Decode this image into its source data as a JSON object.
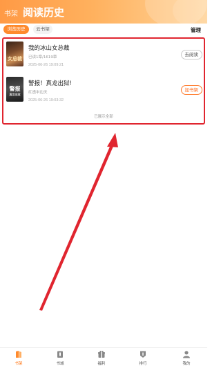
{
  "header": {
    "tabs": [
      {
        "label": "书架",
        "active": false
      },
      {
        "label": "阅读历史",
        "active": true
      }
    ]
  },
  "subbar": {
    "filters": [
      {
        "label": "浏览历史",
        "active": true
      },
      {
        "label": "云书架",
        "active": false
      }
    ],
    "manage_label": "管理"
  },
  "books": [
    {
      "title": "我的冰山女总裁",
      "progress": "已读1章/1619章",
      "time": "2025-06-26 19:09:21",
      "action": "去阅读",
      "cover_text": "女总裁"
    },
    {
      "title": "警报！真龙出狱!",
      "progress": "红透半边天",
      "time": "2025-06-26 19:03:32",
      "action": "加书架",
      "cover_text": "警报",
      "cover_subtext": "真龙出狱"
    }
  ],
  "list_footer": "已展示全部",
  "nav": [
    {
      "label": "书架",
      "icon": "bookshelf-icon",
      "active": true
    },
    {
      "label": "书城",
      "icon": "bookstore-icon",
      "active": false
    },
    {
      "label": "福利",
      "icon": "gift-icon",
      "active": false
    },
    {
      "label": "排行",
      "icon": "rank-icon",
      "active": false
    },
    {
      "label": "我的",
      "icon": "profile-icon",
      "active": false
    }
  ],
  "colors": {
    "accent": "#ff8b2e",
    "annotation_red": "#e0252f"
  }
}
